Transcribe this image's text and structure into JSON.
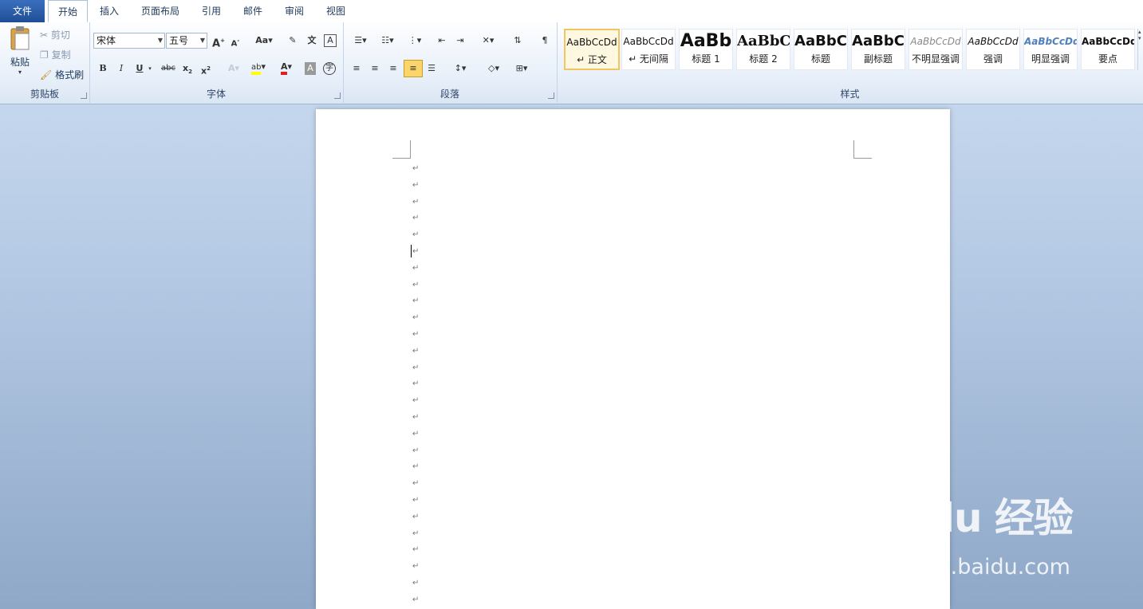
{
  "tabs": [
    "文件",
    "开始",
    "插入",
    "页面布局",
    "引用",
    "邮件",
    "审阅",
    "视图"
  ],
  "clipboard": {
    "paste": "粘贴",
    "cut": "剪切",
    "copy": "复制",
    "format_painter": "格式刷",
    "label": "剪贴板"
  },
  "font": {
    "name": "宋体",
    "size": "五号",
    "label": "字体"
  },
  "paragraph": {
    "label": "段落"
  },
  "styles": {
    "label": "样式",
    "items": [
      {
        "sample": "AaBbCcDd",
        "name": "↵ 正文"
      },
      {
        "sample": "AaBbCcDd",
        "name": "↵ 无间隔"
      },
      {
        "sample": "AaBb",
        "name": "标题 1"
      },
      {
        "sample": "AaBbC",
        "name": "标题 2"
      },
      {
        "sample": "AaBbC",
        "name": "标题"
      },
      {
        "sample": "AaBbC",
        "name": "副标题"
      },
      {
        "sample": "AaBbCcDd",
        "name": "不明显强调"
      },
      {
        "sample": "AaBbCcDd",
        "name": "强调"
      },
      {
        "sample": "AaBbCcDd",
        "name": "明显强调"
      },
      {
        "sample": "AaBbCcDd",
        "name": "要点"
      }
    ]
  },
  "document": {
    "paragraph_mark": "↵"
  },
  "watermark": {
    "logo": "Bai du 经验",
    "url": "jingyan.baidu.com"
  },
  "colors": {
    "file_tab": "#2b579a",
    "selected_style": "#f2c561",
    "background": "#b4c9e4"
  }
}
